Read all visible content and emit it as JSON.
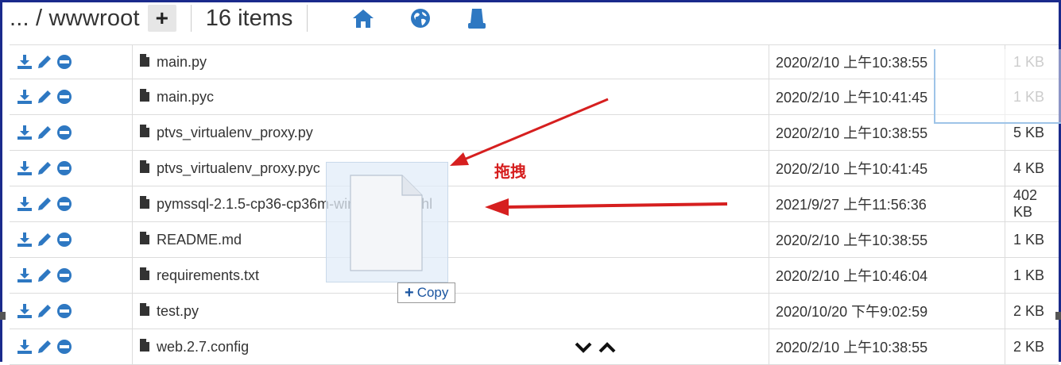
{
  "toolbar": {
    "breadcrumb": "... / wwwroot",
    "add_label": "+",
    "item_count": "16 items",
    "icons": [
      "home-icon",
      "globe-icon",
      "database-icon"
    ]
  },
  "files": [
    {
      "name": "main.py",
      "date": "2020/2/10 上午10:38:55",
      "size": "1 KB"
    },
    {
      "name": "main.pyc",
      "date": "2020/2/10 上午10:41:45",
      "size": "1 KB"
    },
    {
      "name": "ptvs_virtualenv_proxy.py",
      "date": "2020/2/10 上午10:38:55",
      "size": "5 KB"
    },
    {
      "name": "ptvs_virtualenv_proxy.pyc",
      "date": "2020/2/10 上午10:41:45",
      "size": "4 KB"
    },
    {
      "name": "pymssql-2.1.5-cp36-cp36m-win_amd64.whl",
      "date": "2021/9/27 上午11:56:36",
      "size": "402 KB"
    },
    {
      "name": "README.md",
      "date": "2020/2/10 上午10:38:55",
      "size": "1 KB"
    },
    {
      "name": "requirements.txt",
      "date": "2020/2/10 上午10:46:04",
      "size": "1 KB"
    },
    {
      "name": "test.py",
      "date": "2020/10/20 下午9:02:59",
      "size": "2 KB"
    },
    {
      "name": "web.2.7.config",
      "date": "2020/2/10 上午10:38:55",
      "size": "2 KB"
    }
  ],
  "drag": {
    "copy_label": "Copy",
    "copy_plus": "+",
    "annotation": "拖拽"
  },
  "colors": {
    "icon_blue": "#2e78c2",
    "annotation_red": "#d61f1f",
    "frame": "#1a2a8c"
  }
}
